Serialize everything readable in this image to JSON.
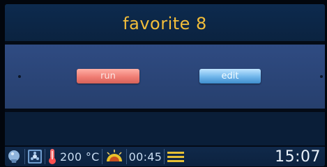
{
  "header": {
    "title": "favorite 8"
  },
  "actions": {
    "run_label": "run",
    "edit_label": "edit"
  },
  "status": {
    "temperature": "200 °C",
    "duration": "00:45",
    "time": "15:07"
  },
  "icons": {
    "status_icons": [
      "light-bulb-icon",
      "fan-mode-icon",
      "thermometer-icon",
      "heating-power-icon",
      "menu-lines-icon"
    ]
  },
  "colors": {
    "title": "#f2bd3a",
    "run_button": "#f07d74",
    "edit_button": "#6fb5ea",
    "panel": "#2f4b82",
    "thermometer": "#ff5a5a"
  }
}
